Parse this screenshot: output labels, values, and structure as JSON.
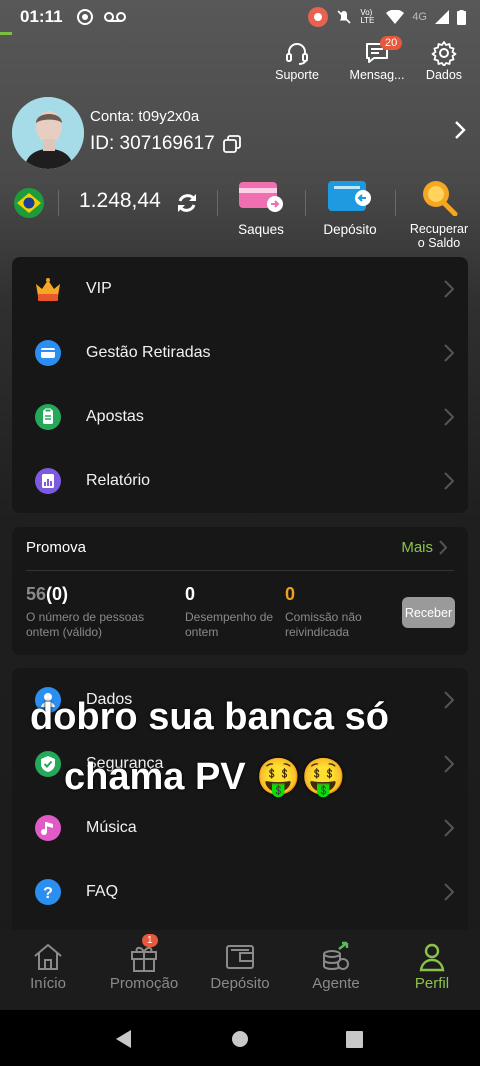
{
  "status_bar": {
    "time": "01:11",
    "network": "4G",
    "volte": "Vo) LTE"
  },
  "top_actions": [
    {
      "label": "Suporte",
      "icon": "headset-icon"
    },
    {
      "label": "Mensag...",
      "icon": "message-icon",
      "badge": "20"
    },
    {
      "label": "Dados",
      "icon": "gear-icon"
    }
  ],
  "profile": {
    "conta": "Conta: t09y2x0a",
    "id": "ID: 307169617"
  },
  "balance": {
    "amount": "1.248,44",
    "currency_flag": "brazil-flag-icon"
  },
  "quick_actions": [
    {
      "label": "Saques",
      "icon": "card-withdraw-icon"
    },
    {
      "label": "Depósito",
      "icon": "wallet-deposit-icon"
    },
    {
      "label": "Recuperar o Saldo",
      "line1": "Recuperar",
      "line2": "o Saldo",
      "icon": "search-coin-icon"
    }
  ],
  "menu1": [
    {
      "label": "VIP",
      "icon": "vip-crown-icon"
    },
    {
      "label": "Gestão Retiradas",
      "icon": "card-icon"
    },
    {
      "label": "Apostas",
      "icon": "clipboard-icon"
    },
    {
      "label": "Relatório",
      "icon": "report-icon"
    }
  ],
  "promo": {
    "title": "Promova",
    "more": "Mais",
    "stat1_val_a": "56",
    "stat1_val_b": "(0)",
    "stat1_l1": "O número de pessoas",
    "stat1_l2": "ontem (válido)",
    "stat2_val": "0",
    "stat2_l1": "Desempenho de",
    "stat2_l2": "ontem",
    "stat3_val": "0",
    "stat3_l1": "Comissão não",
    "stat3_l2": "reivindicada",
    "button": "Receber"
  },
  "menu2": [
    {
      "label": "Dados",
      "icon": "user-icon"
    },
    {
      "label": "Segurança",
      "icon": "shield-icon"
    },
    {
      "label": "Música",
      "icon": "music-icon"
    },
    {
      "label": "FAQ",
      "icon": "question-icon"
    }
  ],
  "overlay": {
    "line1": "dobro sua banca só",
    "line2": "chama PV",
    "emoji": "🤑🤑"
  },
  "bottom_nav": [
    {
      "label": "Início",
      "icon": "home-icon"
    },
    {
      "label": "Promoção",
      "icon": "gift-icon",
      "badge": "1"
    },
    {
      "label": "Depósito",
      "icon": "wallet-icon"
    },
    {
      "label": "Agente",
      "icon": "coins-icon"
    },
    {
      "label": "Perfil",
      "icon": "person-icon",
      "active": true
    }
  ],
  "colors": {
    "accent": "#8bc34a",
    "badge": "#e8583c",
    "commission": "#f0a020"
  }
}
